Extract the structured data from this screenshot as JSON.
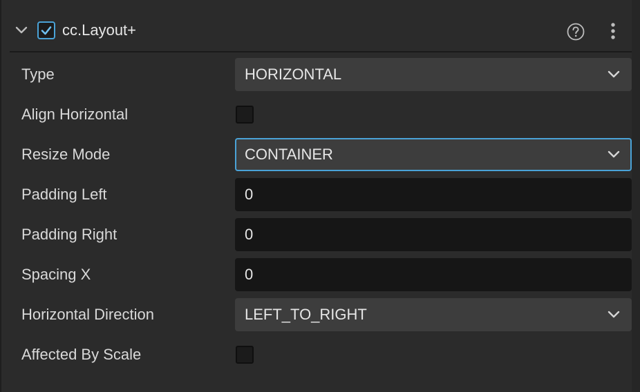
{
  "component": {
    "title": "cc.Layout+",
    "enabled": true
  },
  "properties": [
    {
      "label": "Type",
      "kind": "select",
      "value": "HORIZONTAL"
    },
    {
      "label": "Align Horizontal",
      "kind": "checkbox",
      "checked": false
    },
    {
      "label": "Resize Mode",
      "kind": "select",
      "value": "CONTAINER",
      "focused": true
    },
    {
      "label": "Padding Left",
      "kind": "number",
      "value": "0"
    },
    {
      "label": "Padding Right",
      "kind": "number",
      "value": "0"
    },
    {
      "label": "Spacing X",
      "kind": "number",
      "value": "0"
    },
    {
      "label": "Horizontal Direction",
      "kind": "select",
      "value": "LEFT_TO_RIGHT"
    },
    {
      "label": "Affected By Scale",
      "kind": "checkbox",
      "checked": false
    }
  ],
  "icons": {
    "collapse": "chevron-down-icon",
    "enable": "checkmark-icon",
    "help": "help-circle-icon",
    "more": "more-vertical-icon",
    "dropdown": "chevron-down-icon"
  },
  "colors": {
    "background": "#2b2b2b",
    "accent": "#4aa3d8",
    "select_bg": "#3d3d3d",
    "input_bg": "#161616",
    "text": "#e2e2e2"
  }
}
